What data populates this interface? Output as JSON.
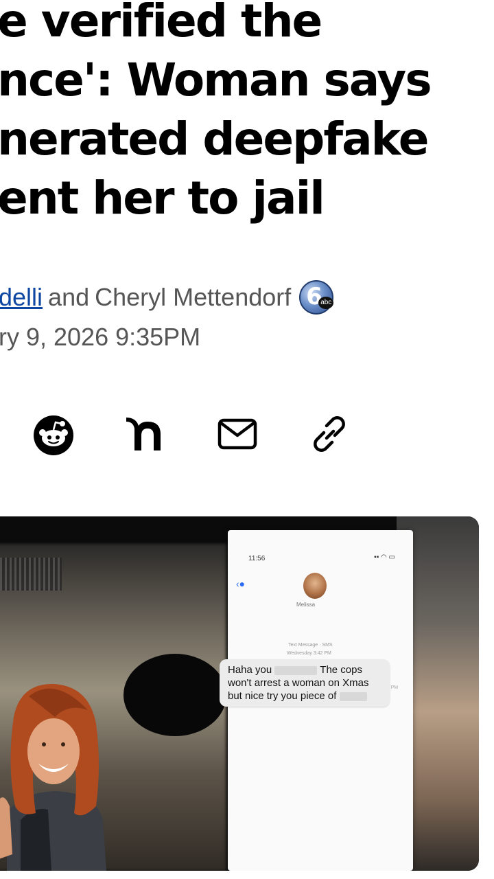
{
  "article": {
    "headline_lines": [
      "e verified the",
      "nce': Woman says",
      "nerated deepfake",
      "ent her to jail"
    ],
    "byline": {
      "author_link": "delli",
      "conjunction": "and",
      "second_author": "Cheryl Mettendorf",
      "station_logo": "6abc-logo"
    },
    "date": "ry 9, 2026 9:35PM"
  },
  "share": {
    "items": [
      {
        "name": "reddit",
        "icon": "reddit-icon"
      },
      {
        "name": "nextdoor",
        "icon": "nextdoor-icon"
      },
      {
        "name": "email",
        "icon": "email-icon"
      },
      {
        "name": "copy-link",
        "icon": "link-icon"
      }
    ]
  },
  "photo": {
    "phone": {
      "status_time": "11:56",
      "contact_name": "Melissa",
      "thread_label": "Text Message · SMS",
      "thread_day": "Wednesday 3:42 PM",
      "bubble_time": "3:42 PM",
      "message": {
        "part1": "Haha you",
        "part2": "The cops won't arrest a woman on Xmas but nice try you piece of"
      }
    }
  }
}
